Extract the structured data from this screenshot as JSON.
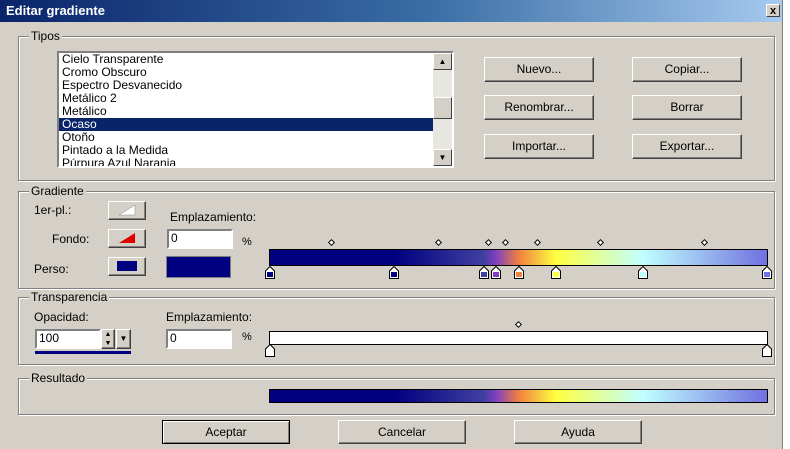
{
  "window": {
    "title": "Editar gradiente",
    "close_glyph": "x"
  },
  "tipos": {
    "label": "Tipos",
    "items": [
      "Cielo Transparente",
      "Cromo Obscuro",
      "Espectro Desvanecido",
      "Metálico 2",
      "Metálico",
      "Ocaso",
      "Otoño",
      "Pintado a la Medida",
      "Púrpura Azul Naranja"
    ],
    "selected_index": 5,
    "buttons": {
      "nuevo": "Nuevo...",
      "copiar": "Copiar...",
      "renombrar": "Renombrar...",
      "borrar": "Borrar",
      "importar": "Importar...",
      "exportar": "Exportar..."
    }
  },
  "gradiente": {
    "label": "Gradiente",
    "primer_plano_label": "1er-pl.:",
    "fondo_label": "Fondo:",
    "perso_label": "Perso:",
    "emplazamiento_label": "Emplazamiento:",
    "emplazamiento_value": "0",
    "percent": "%",
    "perso_color": "#000080",
    "stops": [
      {
        "pos": 0.0,
        "color": "#000080"
      },
      {
        "pos": 0.25,
        "color": "#000080"
      },
      {
        "pos": 0.43,
        "color": "#4040a0"
      },
      {
        "pos": 0.455,
        "color": "#8040c0"
      },
      {
        "pos": 0.5,
        "color": "#f08040"
      },
      {
        "pos": 0.575,
        "color": "#ffff40"
      },
      {
        "pos": 0.75,
        "color": "#c0ffff"
      },
      {
        "pos": 1.0,
        "color": "#7070e0"
      }
    ],
    "midpoints": [
      0.125,
      0.34,
      0.44,
      0.475,
      0.54,
      0.665,
      0.875
    ]
  },
  "transparencia": {
    "label": "Transparencia",
    "opacidad_label": "Opacidad:",
    "opacidad_value": "100",
    "emplazamiento_label": "Emplazamiento:",
    "emplazamiento_value": "0",
    "percent": "%",
    "stops": [
      {
        "pos": 0.0,
        "color": "#ffffff"
      },
      {
        "pos": 1.0,
        "color": "#ffffff"
      }
    ],
    "midpoints": [
      0.5
    ]
  },
  "resultado": {
    "label": "Resultado"
  },
  "footer": {
    "aceptar": "Aceptar",
    "cancelar": "Cancelar",
    "ayuda": "Ayuda"
  },
  "colors": {
    "selection": "#0a246a",
    "window_bg": "#d4d0c8"
  }
}
